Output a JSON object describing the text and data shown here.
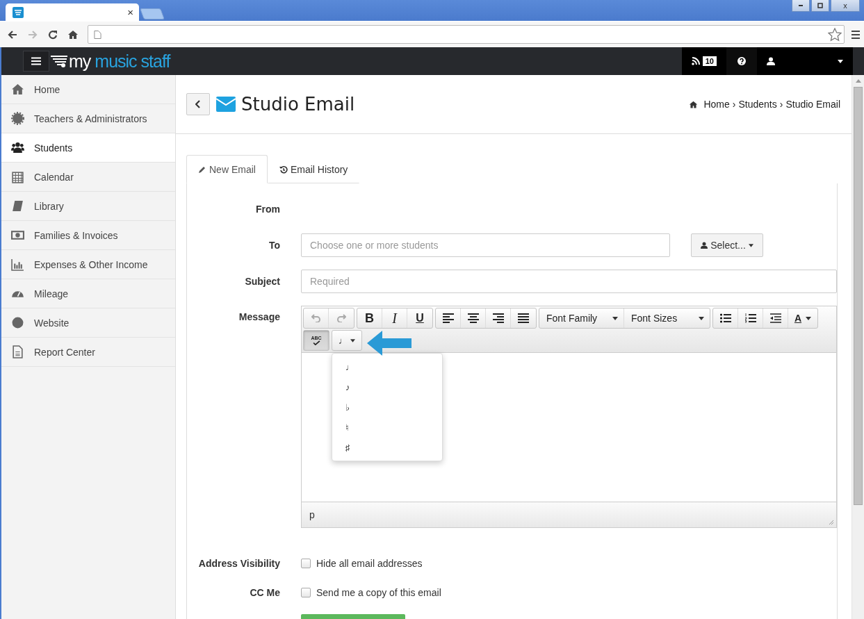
{
  "browser": {
    "tab_close": "×",
    "window_close": "x"
  },
  "header": {
    "logo_my": "my",
    "logo_rest": "music staff",
    "feed_count": "10"
  },
  "sidebar": {
    "items": [
      {
        "label": "Home",
        "selected": false
      },
      {
        "label": "Teachers & Administrators",
        "selected": false
      },
      {
        "label": "Students",
        "selected": true
      },
      {
        "label": "Calendar",
        "selected": false
      },
      {
        "label": "Library",
        "selected": false
      },
      {
        "label": "Families & Invoices",
        "selected": false
      },
      {
        "label": "Expenses & Other Income",
        "selected": false
      },
      {
        "label": "Mileage",
        "selected": false
      },
      {
        "label": "Website",
        "selected": false
      },
      {
        "label": "Report Center",
        "selected": false
      }
    ]
  },
  "page": {
    "title": "Studio Email",
    "breadcrumb": [
      {
        "label": "Home"
      },
      {
        "separator": "›",
        "label": "Students"
      },
      {
        "separator": "›",
        "label": "Studio Email"
      }
    ]
  },
  "tabs": [
    {
      "label": "New Email",
      "selected": true
    },
    {
      "label": "Email History",
      "selected": false
    }
  ],
  "form": {
    "from_label": "From",
    "to_label": "To",
    "to_placeholder": "Choose one or more students",
    "select_button": "Select...",
    "subject_label": "Subject",
    "subject_placeholder": "Required",
    "message_label": "Message"
  },
  "editor": {
    "undo_disabled": true,
    "redo_disabled": true,
    "bold": "B",
    "italic": "I",
    "underline": "U",
    "font_family": "Font Family",
    "font_sizes": "Font Sizes",
    "text_color": "A",
    "spellcheck_label": "ABC",
    "spellcheck_active": true,
    "note_button": "♩",
    "status_path": "p"
  },
  "note_menu": {
    "open": true,
    "items": [
      "♩",
      "♪",
      "♭",
      "♮",
      "♯"
    ]
  },
  "options": [
    {
      "label": "Address Visibility",
      "text": "Hide all email addresses",
      "checked": false
    },
    {
      "label": "CC Me",
      "text": "Send me a copy of this email",
      "checked": false
    }
  ]
}
